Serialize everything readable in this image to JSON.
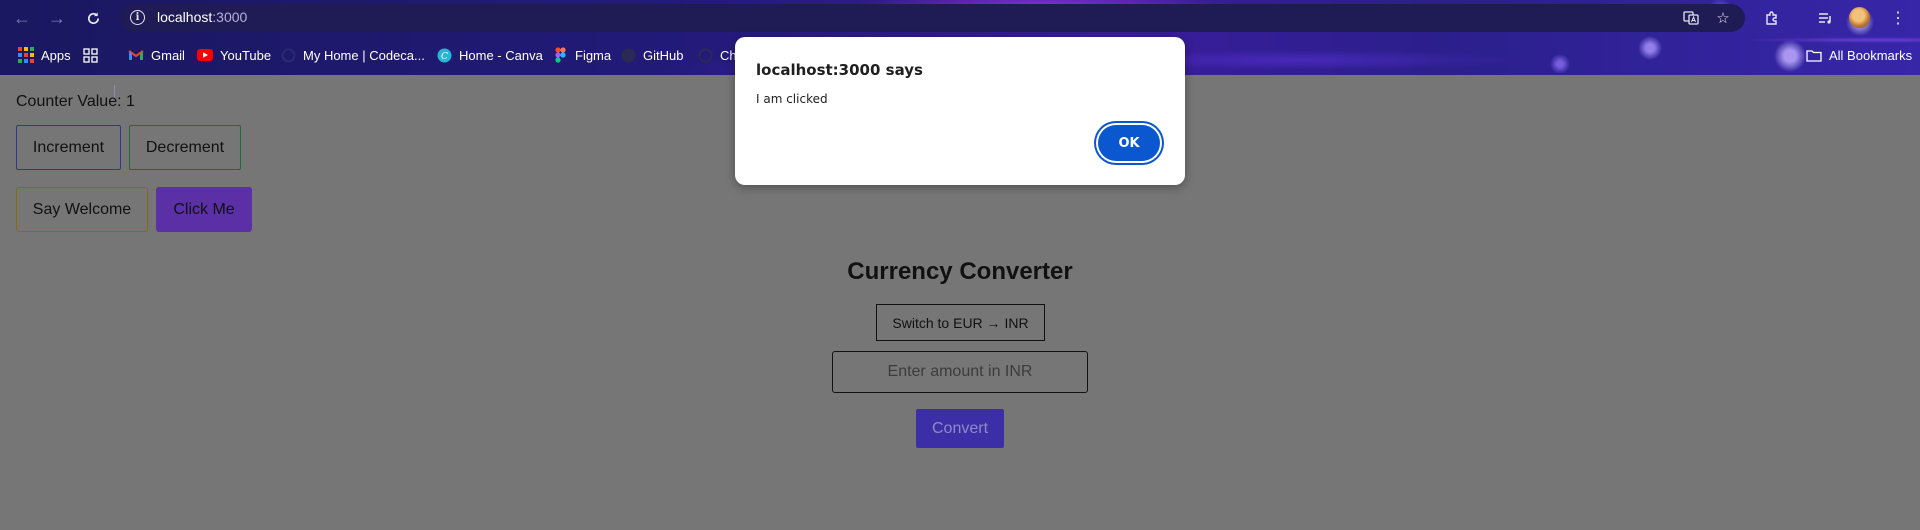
{
  "browser": {
    "url_host": "localhost",
    "url_port": ":3000",
    "bookmarks": [
      {
        "label": "Apps",
        "icon": "apps-grid-icon"
      },
      {
        "label": "",
        "icon": "google-apps-icon"
      },
      {
        "label": "Gmail",
        "icon": "gmail-icon"
      },
      {
        "label": "YouTube",
        "icon": "youtube-icon"
      },
      {
        "label": "My Home | Codeca...",
        "icon": "codecademy-icon"
      },
      {
        "label": "Home - Canva",
        "icon": "canva-icon"
      },
      {
        "label": "Figma",
        "icon": "figma-icon"
      },
      {
        "label": "GitHub",
        "icon": "github-icon"
      },
      {
        "label": "Ch",
        "icon": "chatgpt-icon"
      }
    ],
    "all_bookmarks": "All Bookmarks"
  },
  "page": {
    "counter_text": "Counter Value: 1",
    "increment_label": "Increment",
    "decrement_label": "Decrement",
    "say_welcome_label": "Say Welcome",
    "click_me_label": "Click Me",
    "currency": {
      "title": "Currency Converter",
      "switch_label": "Switch to EUR → INR",
      "amount_placeholder": "Enter amount in INR",
      "convert_label": "Convert"
    }
  },
  "dialog": {
    "title": "localhost:3000 says",
    "message": "I am clicked",
    "ok_label": "OK"
  },
  "colors": {
    "overlay_bg": "#767676",
    "dialog_ok": "#0b57d0",
    "click_me_bg": "#5b2fa6",
    "convert_bg": "#3c2ea6"
  }
}
